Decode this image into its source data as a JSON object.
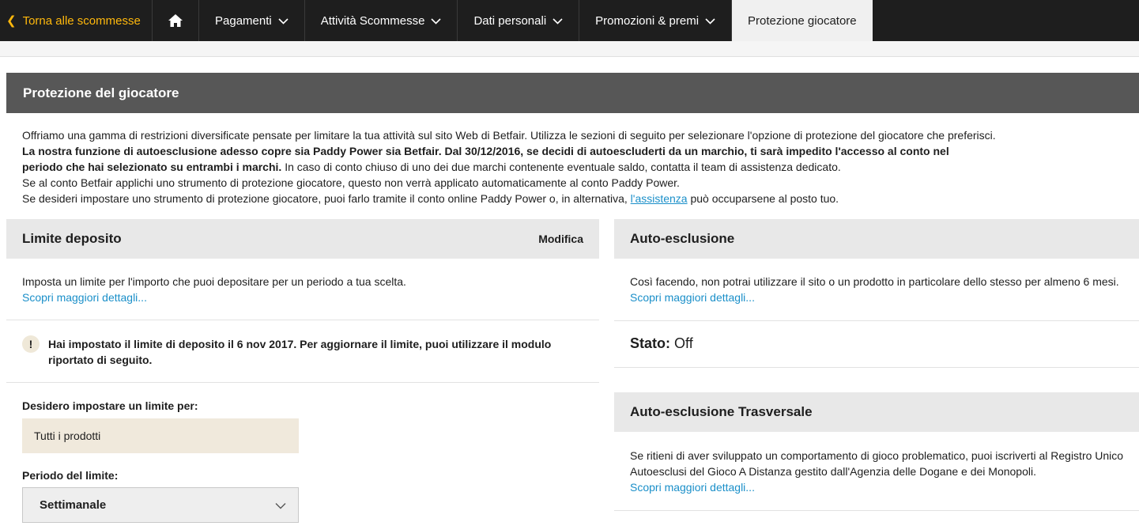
{
  "nav": {
    "back_label": "Torna alle scommesse",
    "home_icon": "home-icon",
    "items": [
      {
        "label": "Pagamenti"
      },
      {
        "label": "Attività Scommesse"
      },
      {
        "label": "Dati personali"
      },
      {
        "label": "Promozioni & premi"
      }
    ],
    "active_label": "Protezione giocatore"
  },
  "page": {
    "title": "Protezione del giocatore",
    "intro": {
      "line1": "Offriamo una gamma di restrizioni diversificate pensate per limitare la tua attività sul sito Web di Betfair. Utilizza le sezioni di seguito per selezionare l'opzione di protezione del giocatore che preferisci.",
      "line2_bold": "La nostra funzione di autoesclusione adesso copre sia Paddy Power sia Betfair. Dal 30/12/2016, se decidi di autoescluderti da un marchio, ti sarà impedito l'accesso al conto nel",
      "line3_bold": "periodo che hai selezionato su entrambi i marchi.",
      "line3_rest": " In caso di conto chiuso di uno dei due marchi contenente eventuale saldo, contatta il team di assistenza dedicato.",
      "line4": "Se al conto Betfair applichi uno strumento di protezione giocatore, questo non verrà applicato automaticamente al conto Paddy Power.",
      "line5_pre": "Se desideri impostare uno strumento di protezione giocatore, puoi farlo tramite il conto online Paddy Power o, in alternativa, ",
      "line5_link": "l'assistenza",
      "line5_post": " può occuparsene al posto tuo."
    }
  },
  "deposit": {
    "title": "Limite deposito",
    "action": "Modifica",
    "description": "Imposta un limite per l'importo che puoi depositare per un periodo a tua scelta.",
    "more_link": "Scopri maggiori dettagli...",
    "notice_icon": "!",
    "notice_line1": "Hai impostato il limite di deposito il 6 nov 2017. Per aggiornare il limite, puoi utilizzare il modulo",
    "notice_line2": "riportato di seguito.",
    "limit_for_label": "Desidero impostare un limite per:",
    "limit_for_value": "Tutti i prodotti",
    "period_label": "Periodo del limite:",
    "period_value": "Settimanale"
  },
  "self_exclusion": {
    "title": "Auto-esclusione",
    "description": "Così facendo, non potrai utilizzare il sito o un prodotto in particolare dello stesso per almeno 6 mesi.",
    "more_link": "Scopri maggiori dettagli...",
    "status_label": "Stato:",
    "status_value": "Off"
  },
  "cross_exclusion": {
    "title": "Auto-esclusione Trasversale",
    "line1": "Se ritieni di aver sviluppato un comportamento di gioco problematico, puoi iscriverti al Registro Unico",
    "line2": "Autoesclusi del Gioco A Distanza gestito dall'Agenzia delle Dogane e dei Monopoli.",
    "more_link": "Scopri maggiori dettagli..."
  },
  "colors": {
    "nav_bg": "#1e1e1e",
    "back_link": "#ffb80c",
    "header_bg": "#575757",
    "card_head_bg": "#e8e8e8",
    "link": "#1a8fc9",
    "prod_box_bg": "#f0e9dc"
  }
}
